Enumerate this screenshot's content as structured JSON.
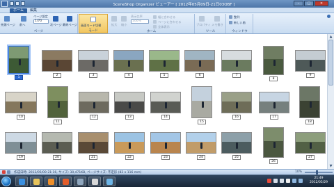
{
  "window": {
    "title": "SceneShop Organizer ビューアー [ 2012年05月09日-21日03OBF ]",
    "minimize_glyph": "–",
    "maximize_glyph": "□",
    "close_glyph": "×"
  },
  "menu": {
    "tabs": [
      "ホーム",
      "編集"
    ]
  },
  "ribbon": {
    "groups": {
      "page": "ページ",
      "mode": "モード",
      "home": "ホーム",
      "tools": "ツール",
      "window": "ウィンドウ"
    },
    "items": {
      "prev_page": "先頭ページ",
      "prev": "前へ",
      "page_size_label": "ページ設定",
      "page_size_value": "1/70",
      "next_page": "次ページ",
      "last_page": "最終ページ",
      "mode_toggle": "画面モード切替",
      "expand": "拡大",
      "shrink": "縮小",
      "zoom_label": "表示比率",
      "zoom_value": "100%",
      "fit_width": "幅に合わせる",
      "fit_page": "ページに合わせる",
      "display_all": "全体表示",
      "properties": "プロパティ",
      "memo": "メモ書き",
      "order": "整列",
      "window": "新しい画"
    }
  },
  "thumbnails": [
    {
      "num": "1",
      "sky": "#7e9a73",
      "ground": "#3d5a35",
      "selected": true
    },
    {
      "num": "2",
      "sky": "#8b7a61",
      "ground": "#5a4634"
    },
    {
      "num": "3",
      "sky": "#c9d2da",
      "ground": "#6c6a66"
    },
    {
      "num": "4",
      "sky": "#8aa6c0",
      "ground": "#6a7050"
    },
    {
      "num": "5",
      "sky": "#9ab88a",
      "ground": "#5f7146"
    },
    {
      "num": "6",
      "sky": "#a0b5c3",
      "ground": "#7a6b55"
    },
    {
      "num": "7",
      "sky": "#d7dcdf",
      "ground": "#6b7b5f"
    },
    {
      "num": "8",
      "sky": "#6f7d62",
      "ground": "#4a5a3f"
    },
    {
      "num": "9",
      "sky": "#c4ccd2",
      "ground": "#4e5958"
    },
    {
      "num": "10",
      "sky": "#d8d4c8",
      "ground": "#85775c"
    },
    {
      "num": "11",
      "sky": "#7e8f5f",
      "ground": "#51623b"
    },
    {
      "num": "12",
      "sky": "#b8b7ac",
      "ground": "#6d6a5e"
    },
    {
      "num": "13",
      "sky": "#c7c9c4",
      "ground": "#4a4a48"
    },
    {
      "num": "14",
      "sky": "#d1d3cf",
      "ground": "#595b55"
    },
    {
      "num": "15",
      "sky": "#c4d1dd",
      "ground": "#a9aaa2"
    },
    {
      "num": "16",
      "sky": "#9aa088",
      "ground": "#6e6d58"
    },
    {
      "num": "17",
      "sky": "#c7d5e3",
      "ground": "#76807e"
    },
    {
      "num": "18",
      "sky": "#6c7766",
      "ground": "#3b4233"
    },
    {
      "num": "19",
      "sky": "#cdd9e4",
      "ground": "#7f8f96"
    },
    {
      "num": "20",
      "sky": "#b5b9b0",
      "ground": "#5b5d52"
    },
    {
      "num": "21",
      "sky": "#a88f6e",
      "ground": "#5a4937"
    },
    {
      "num": "22",
      "sky": "#9cc3e3",
      "ground": "#c99a5a"
    },
    {
      "num": "23",
      "sky": "#a3c6e6",
      "ground": "#b9854e"
    },
    {
      "num": "24",
      "sky": "#b2d0ea",
      "ground": "#c19c69"
    },
    {
      "num": "25",
      "sky": "#8da0a9",
      "ground": "#4c5c5f"
    },
    {
      "num": "26",
      "sky": "#7d8d6c",
      "ground": "#4b5740"
    },
    {
      "num": "27",
      "sky": "#8d9e7c",
      "ground": "#526045"
    }
  ],
  "status": {
    "text": "作成日時: 2012/05/09 21:16, サイズ: 30,471KB, ページサイズ: 不定形 (82 x 116 mm)",
    "zoom": "10%"
  },
  "taskbar": {
    "apps": [
      {
        "name": "internet-explorer",
        "color": "#3a8fe0"
      },
      {
        "name": "file-explorer",
        "color": "#e7c35a"
      },
      {
        "name": "media-player",
        "color": "#ef8f2a"
      },
      {
        "name": "firefox",
        "color": "#e35d2a"
      },
      {
        "name": "disk-tool",
        "color": "#8fa6bd"
      },
      {
        "name": "document-viewer",
        "color": "#d8d8d8"
      },
      {
        "name": "scanner-app",
        "color": "#6cb4e6"
      }
    ],
    "clock_time": "21:49",
    "clock_date": "2012/05/29"
  }
}
